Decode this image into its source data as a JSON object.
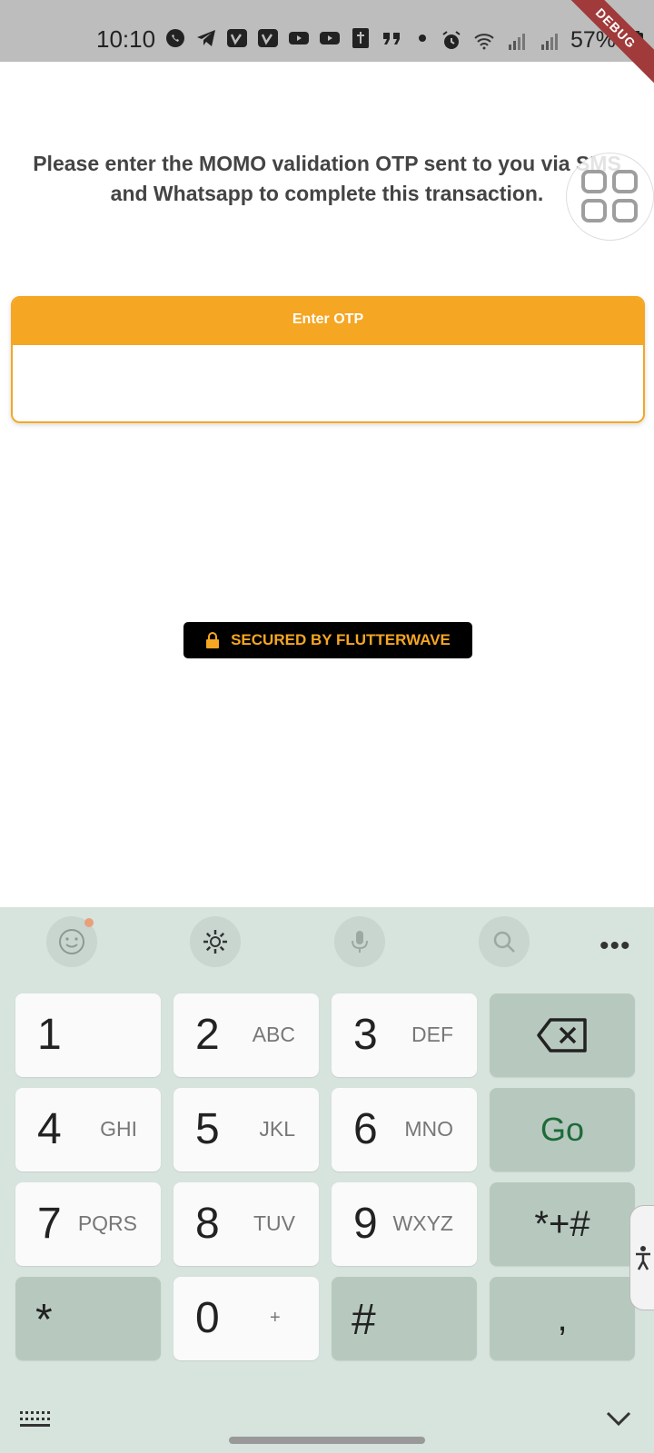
{
  "status_bar": {
    "time": "10:10",
    "battery": "57%",
    "debug_label": "DEBUG",
    "icons": [
      "whatsapp-icon",
      "telegram-icon",
      "vimeo-icon",
      "vimeo-icon",
      "youtube-icon",
      "youtube-icon",
      "bible-icon",
      "quote-icon",
      "dot-icon",
      "alarm-icon",
      "wifi-icon",
      "signal-icon",
      "signal-icon",
      "battery-icon"
    ]
  },
  "main": {
    "instruction": "Please enter the MOMO validation OTP sent to you via SMS and Whatsapp to complete this transaction.",
    "otp_header": "Enter OTP",
    "otp_value": "",
    "secured_label": "SECURED BY FLUTTERWAVE"
  },
  "keyboard": {
    "toolbar": [
      "emoji-icon",
      "settings-icon",
      "mic-icon",
      "search-icon",
      "more-icon"
    ],
    "more_label": "•••",
    "keys": [
      {
        "num": "1",
        "letters": ""
      },
      {
        "num": "2",
        "letters": "ABC"
      },
      {
        "num": "3",
        "letters": "DEF"
      },
      {
        "num": "4",
        "letters": "GHI"
      },
      {
        "num": "5",
        "letters": "JKL"
      },
      {
        "num": "6",
        "letters": "MNO"
      },
      {
        "num": "7",
        "letters": "PQRS"
      },
      {
        "num": "8",
        "letters": "TUV"
      },
      {
        "num": "9",
        "letters": "WXYZ"
      },
      {
        "num": "0",
        "letters": "+"
      }
    ],
    "go_label": "Go",
    "symbols_label": "*+#",
    "star_label": "*",
    "hash_label": "#",
    "comma_label": ","
  },
  "colors": {
    "accent": "#f5a623",
    "keyboard_bg": "#d7e3dd",
    "func_key": "#b7c9bf",
    "go_text": "#1e6a3a"
  }
}
